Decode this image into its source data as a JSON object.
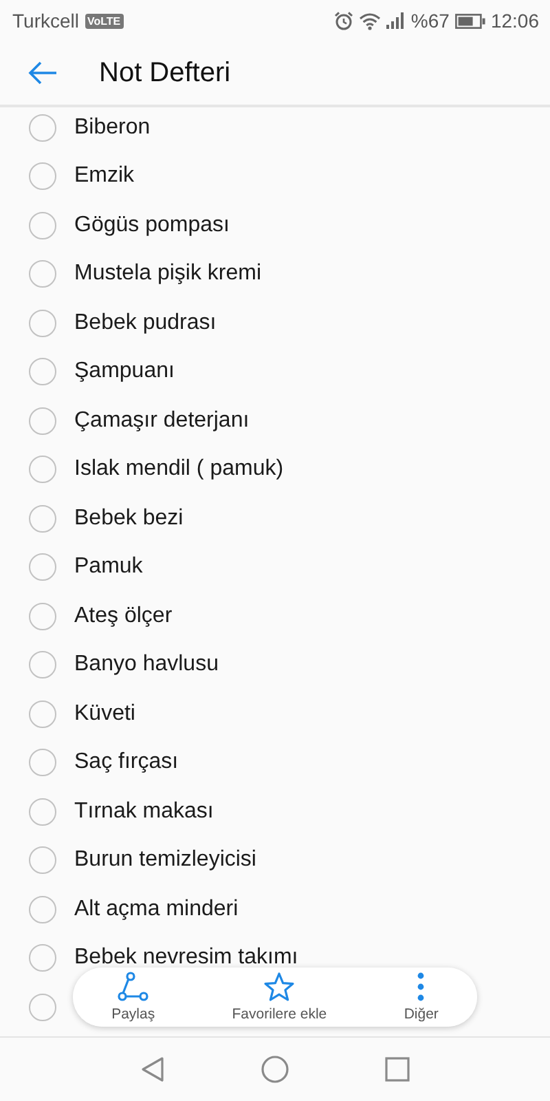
{
  "status_bar": {
    "carrier": "Turkcell",
    "volte_badge": "VoLTE",
    "battery_text": "%67",
    "time": "12:06"
  },
  "header": {
    "title": "Not Defteri"
  },
  "items": [
    {
      "text": "Biberon",
      "checked": false
    },
    {
      "text": "Emzik",
      "checked": false
    },
    {
      "text": "Gögüs pompası",
      "checked": false
    },
    {
      "text": "Mustela pişik kremi",
      "checked": false
    },
    {
      "text": "Bebek pudrası",
      "checked": false
    },
    {
      "text": "Şampuanı",
      "checked": false
    },
    {
      "text": "Çamaşır deterjanı",
      "checked": false
    },
    {
      "text": "Islak mendil ( pamuk)",
      "checked": false
    },
    {
      "text": "Bebek bezi",
      "checked": false
    },
    {
      "text": "Pamuk",
      "checked": false
    },
    {
      "text": "Ateş ölçer",
      "checked": false
    },
    {
      "text": "Banyo havlusu",
      "checked": false
    },
    {
      "text": "Küveti",
      "checked": false
    },
    {
      "text": "Saç fırçası",
      "checked": false
    },
    {
      "text": "Tırnak makası",
      "checked": false
    },
    {
      "text": "Burun temizleyicisi",
      "checked": false
    },
    {
      "text": "Alt açma minderi",
      "checked": false
    },
    {
      "text": "Bebek nevresim takımı",
      "checked": false
    },
    {
      "checked": false
    }
  ],
  "action_bar": [
    {
      "kind": "share",
      "label": "Paylaş"
    },
    {
      "kind": "star",
      "label": "Favorilere ekle"
    },
    {
      "kind": "more",
      "label": "Diğer"
    }
  ]
}
